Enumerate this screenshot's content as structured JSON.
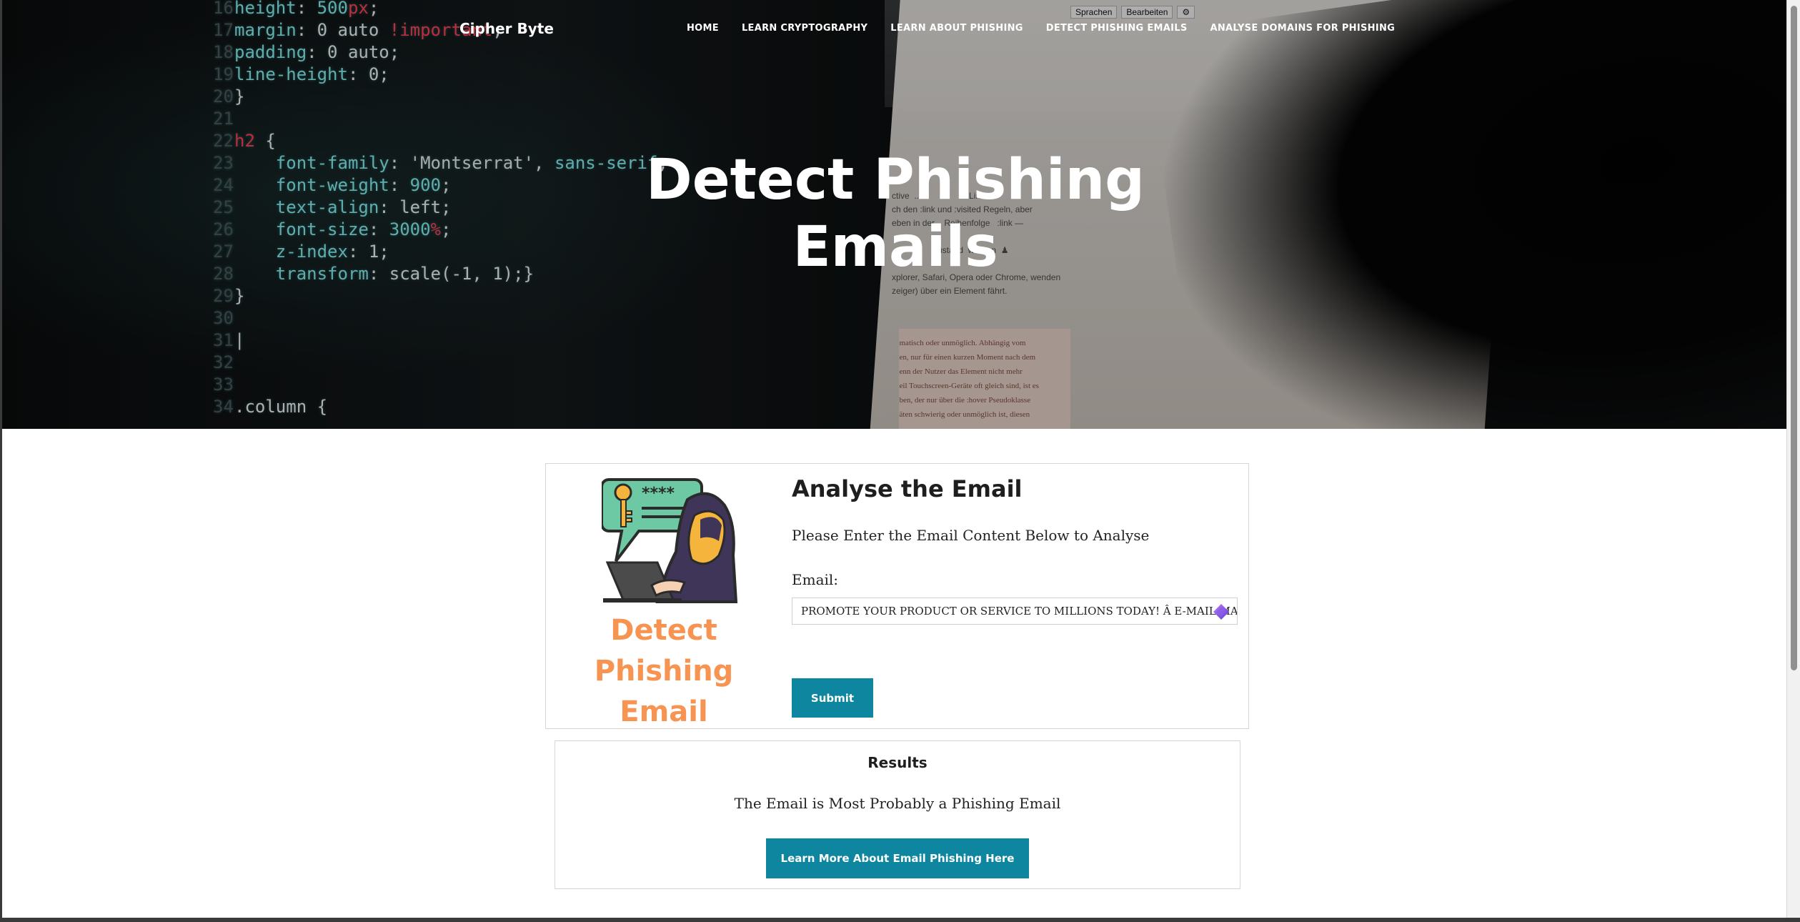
{
  "site": {
    "brand": "Cipher Byte"
  },
  "nav": {
    "items": [
      {
        "label": "HOME"
      },
      {
        "label": "LEARN CRYPTOGRAPHY"
      },
      {
        "label": "LEARN ABOUT PHISHING"
      },
      {
        "label": "DETECT PHISHING EMAILS"
      },
      {
        "label": "ANALYSE DOMAINS FOR PHISHING"
      }
    ]
  },
  "hero": {
    "title_line1": "Detect Phishing",
    "title_line2": "Emails"
  },
  "analyse": {
    "illustration_caption_line1": "Detect Phishing",
    "illustration_caption_line2": "Email",
    "title": "Analyse the Email",
    "subtitle": "Please Enter the Email Content Below to Analyse",
    "email_label": "Email:",
    "email_value": "PROMOTE YOUR PRODUCT OR SERVICE TO MILLIONS TODAY! Â  E-MAIL MARKETING",
    "submit_label": "Submit"
  },
  "results": {
    "title": "Results",
    "message": "The Email is Most Probably a Phishing Email",
    "learn_more_label": "Learn More About Email Phishing Here"
  },
  "colors": {
    "accent": "#0e86a0",
    "caption_orange": "#f79452"
  },
  "icons": {
    "illustration": "phishing-hacker-illustration",
    "input_extension": "gem-extension-icon"
  }
}
